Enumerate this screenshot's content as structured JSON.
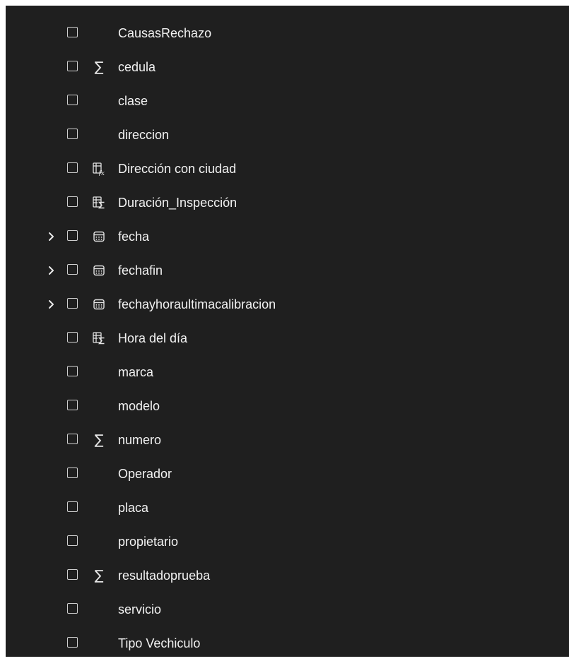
{
  "fields": [
    {
      "label": "CausasRechazo",
      "icon": "none",
      "expandable": false
    },
    {
      "label": "cedula",
      "icon": "sigma-icon",
      "expandable": false
    },
    {
      "label": "clase",
      "icon": "none",
      "expandable": false
    },
    {
      "label": "direccion",
      "icon": "none",
      "expandable": false
    },
    {
      "label": "Dirección con ciudad",
      "icon": "calculated-column-icon",
      "expandable": false
    },
    {
      "label": "Duración_Inspección",
      "icon": "measure-table-icon",
      "expandable": false
    },
    {
      "label": "fecha",
      "icon": "calendar-icon",
      "expandable": true
    },
    {
      "label": "fechafin",
      "icon": "calendar-icon",
      "expandable": true
    },
    {
      "label": "fechayhoraultimacalibracion",
      "icon": "calendar-icon",
      "expandable": true
    },
    {
      "label": "Hora del día",
      "icon": "measure-table-icon",
      "expandable": false
    },
    {
      "label": "marca",
      "icon": "none",
      "expandable": false
    },
    {
      "label": "modelo",
      "icon": "none",
      "expandable": false
    },
    {
      "label": "numero",
      "icon": "sigma-icon",
      "expandable": false
    },
    {
      "label": "Operador",
      "icon": "none",
      "expandable": false
    },
    {
      "label": "placa",
      "icon": "none",
      "expandable": false
    },
    {
      "label": "propietario",
      "icon": "none",
      "expandable": false
    },
    {
      "label": "resultadoprueba",
      "icon": "sigma-icon",
      "expandable": false
    },
    {
      "label": "servicio",
      "icon": "none",
      "expandable": false
    },
    {
      "label": "Tipo Vechiculo",
      "icon": "none",
      "expandable": false
    }
  ],
  "colors": {
    "panel_background": "#1f1f1f",
    "text": "#f2f2f2",
    "icon": "#e4e4e4",
    "checkbox_border": "#cfcfcf"
  }
}
